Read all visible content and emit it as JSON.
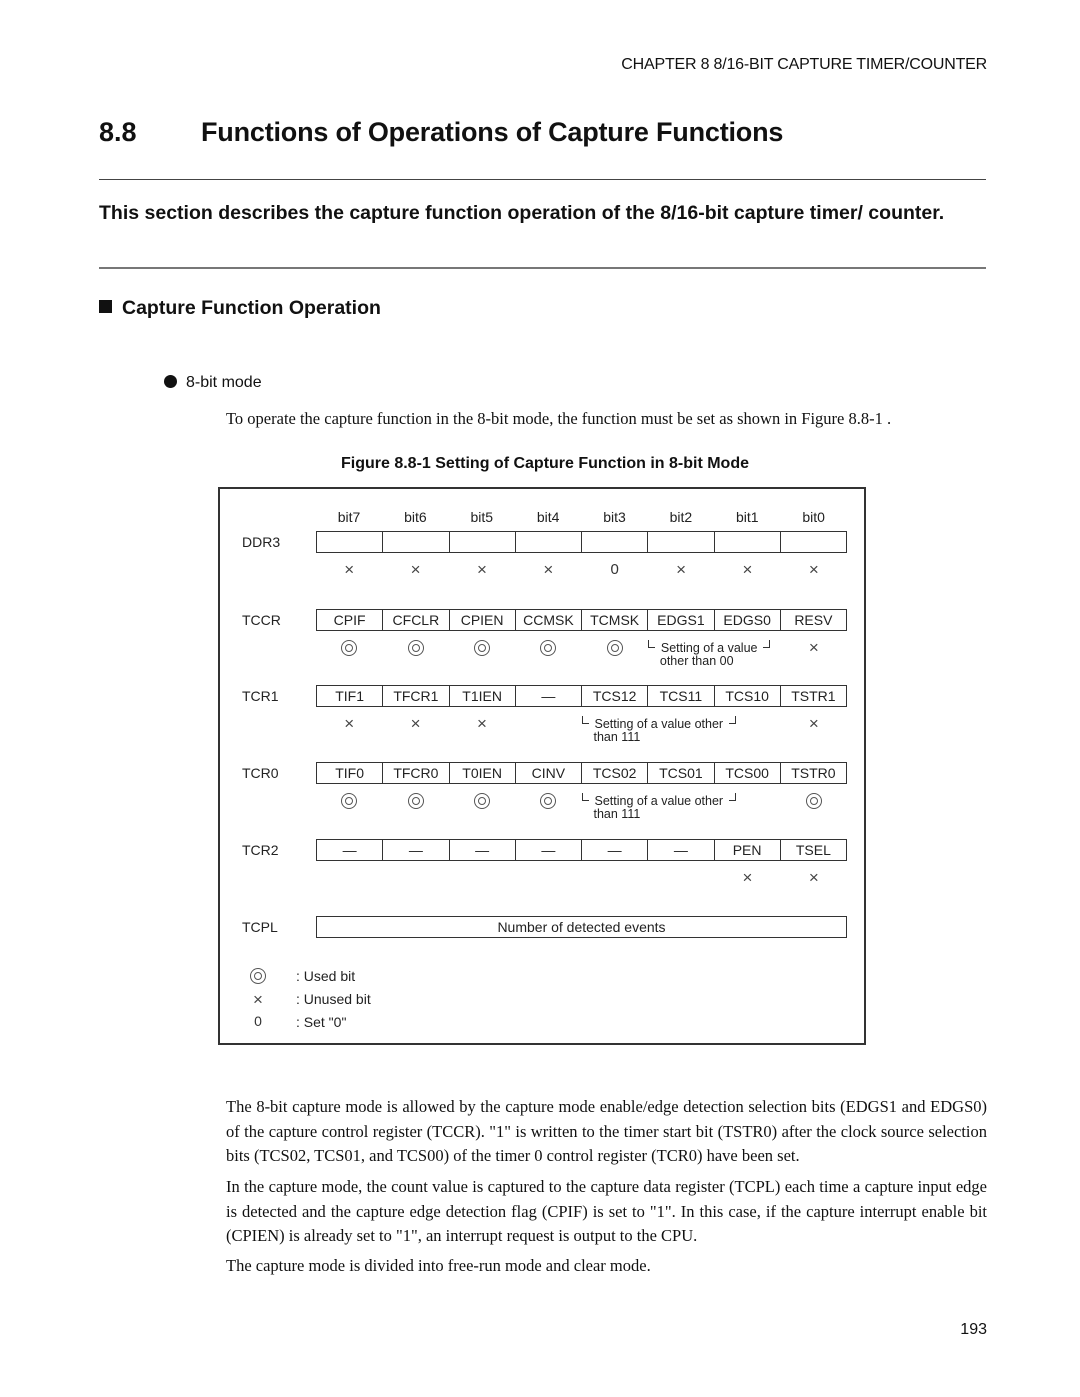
{
  "header": {
    "running_header": "CHAPTER 8  8/16-BIT CAPTURE TIMER/COUNTER",
    "section_number": "8.8",
    "section_title": "Functions of Operations of Capture Functions",
    "summary": "This section describes the capture function operation of the 8/16-bit capture timer/ counter."
  },
  "subsection": {
    "title": "Capture Function Operation",
    "bullet": "8-bit mode",
    "intro": "To operate the capture function in the 8-bit mode, the function must be set as shown in Figure 8.8-1 ."
  },
  "figure": {
    "caption": "Figure 8.8-1  Setting of Capture Function in 8-bit Mode",
    "bit_labels": [
      "bit7",
      "bit6",
      "bit5",
      "bit4",
      "bit3",
      "bit2",
      "bit1",
      "bit0"
    ],
    "registers": [
      {
        "name": "DDR3",
        "cells": [
          "",
          "",
          "",
          "",
          "",
          "",
          "",
          ""
        ],
        "marks": [
          "x",
          "x",
          "x",
          "x",
          "0",
          "x",
          "x",
          "x"
        ],
        "note": ""
      },
      {
        "name": "TCCR",
        "cells": [
          "CPIF",
          "CFCLR",
          "CPIEN",
          "CCMSK",
          "TCMSK",
          "EDGS1",
          "EDGS0",
          "RESV"
        ],
        "marks": [
          "used",
          "used",
          "used",
          "used",
          "used",
          "",
          "",
          "x"
        ],
        "note": [
          "Setting of a value",
          "other than 00"
        ]
      },
      {
        "name": "TCR1",
        "cells": [
          "TIF1",
          "TFCR1",
          "T1IEN",
          "—",
          "TCS12",
          "TCS11",
          "TCS10",
          "TSTR1"
        ],
        "marks": [
          "x",
          "x",
          "x",
          "",
          "",
          "",
          "",
          "x"
        ],
        "note": [
          "Setting of a value other",
          "than 111"
        ]
      },
      {
        "name": "TCR0",
        "cells": [
          "TIF0",
          "TFCR0",
          "T0IEN",
          "CINV",
          "TCS02",
          "TCS01",
          "TCS00",
          "TSTR0"
        ],
        "marks": [
          "used",
          "used",
          "used",
          "used",
          "",
          "",
          "",
          "used"
        ],
        "note": [
          "Setting of a value other",
          "than 111"
        ]
      },
      {
        "name": "TCR2",
        "cells": [
          "—",
          "—",
          "—",
          "—",
          "—",
          "—",
          "PEN",
          "TSEL"
        ],
        "marks": [
          "",
          "",
          "",
          "",
          "",
          "",
          "x",
          "x"
        ],
        "note": ""
      }
    ],
    "tcpl": {
      "name": "TCPL",
      "value": "Number of detected events"
    },
    "legend": [
      {
        "symbol": "used",
        "label": ":  Used bit"
      },
      {
        "symbol": "x",
        "label": ":  Unused bit"
      },
      {
        "symbol": "0",
        "label": ":  Set \"0\""
      }
    ]
  },
  "body": {
    "paragraphs": [
      "The 8-bit capture mode is allowed by the capture mode enable/edge detection selection bits (EDGS1 and EDGS0) of the capture control register (TCCR). \"1\" is written to the timer start bit (TSTR0) after the clock source selection bits (TCS02, TCS01, and TCS00) of the timer 0 control register (TCR0) have been set.",
      "In the capture mode, the count value is captured to the capture data register (TCPL) each time a capture input edge is detected and the capture edge detection flag (CPIF) is set to \"1\". In this case, if the capture interrupt enable bit (CPIEN) is already set to \"1\", an interrupt request is output to the CPU.",
      "The capture mode is divided into free-run mode and clear mode."
    ]
  },
  "footer": {
    "page_number": "193"
  }
}
